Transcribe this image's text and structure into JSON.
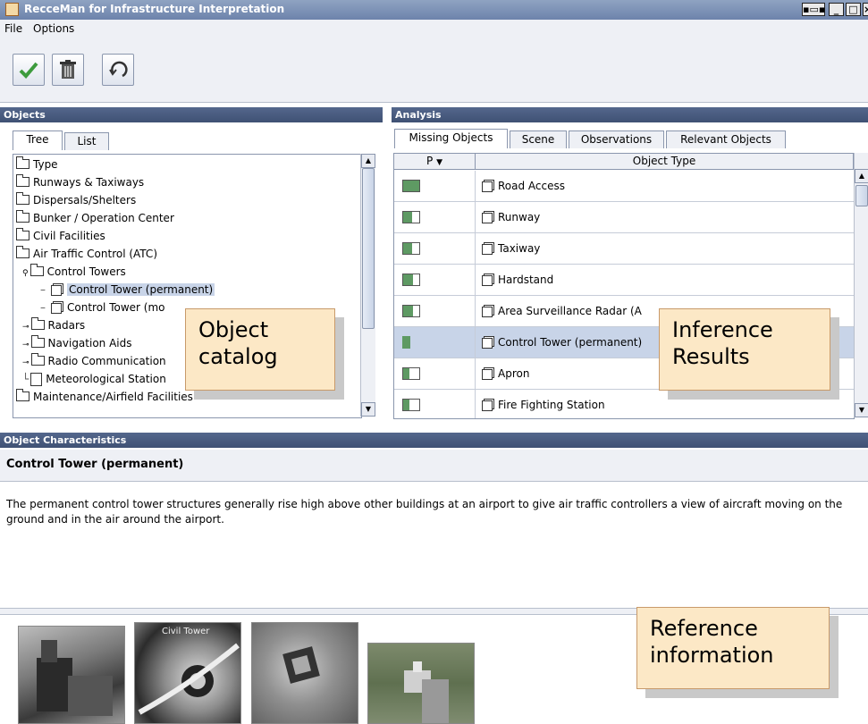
{
  "window": {
    "title": "RecceMan for Infrastructure Interpretation"
  },
  "menu": [
    "File",
    "Options"
  ],
  "toolbar": {
    "icons": [
      "checkmark-icon",
      "trash-icon",
      "refresh-icon"
    ]
  },
  "objects_panel": {
    "header": "Objects",
    "tabs": [
      "Tree",
      "List"
    ],
    "tree_items": [
      {
        "label": "Type",
        "indent": 0,
        "icon": "folder"
      },
      {
        "label": "Runways & Taxiways",
        "indent": 0,
        "icon": "folder"
      },
      {
        "label": "Dispersals/Shelters",
        "indent": 0,
        "icon": "folder"
      },
      {
        "label": "Bunker / Operation Center",
        "indent": 0,
        "icon": "folder"
      },
      {
        "label": "Civil Facilities",
        "indent": 0,
        "icon": "folder"
      },
      {
        "label": "Air Traffic Control (ATC)",
        "indent": 0,
        "icon": "folder"
      },
      {
        "label": "Control Towers",
        "indent": 1,
        "icon": "folder"
      },
      {
        "label": "Control Tower (permanent)",
        "indent": 2,
        "icon": "cube",
        "selected": true
      },
      {
        "label": "Control Tower (mo",
        "indent": 2,
        "icon": "cube"
      },
      {
        "label": "Radars",
        "indent": 1,
        "icon": "folder"
      },
      {
        "label": "Navigation Aids",
        "indent": 1,
        "icon": "folder"
      },
      {
        "label": "Radio Communication",
        "indent": 1,
        "icon": "folder"
      },
      {
        "label": "Meteorological Station",
        "indent": 1,
        "icon": "doc"
      },
      {
        "label": "Maintenance/Airfield Facilities",
        "indent": 0,
        "icon": "folder"
      }
    ]
  },
  "analysis_panel": {
    "header": "Analysis",
    "tabs": [
      "Missing Objects",
      "Scene",
      "Observations",
      "Relevant Objects"
    ],
    "columns": [
      "P",
      "Object Type"
    ],
    "rows": [
      {
        "type": "Road Access",
        "p": 1.0
      },
      {
        "type": "Runway",
        "p": 0.55
      },
      {
        "type": "Taxiway",
        "p": 0.55
      },
      {
        "type": "Hardstand",
        "p": 0.6
      },
      {
        "type": "Area Surveillance Radar (A",
        "p": 0.6
      },
      {
        "type": "Control Tower (permanent)",
        "p": 0.45,
        "selected": true
      },
      {
        "type": "Apron",
        "p": 0.4
      },
      {
        "type": "Fire Fighting Station",
        "p": 0.4
      }
    ]
  },
  "callouts": {
    "catalog": [
      "Object",
      "catalog"
    ],
    "inference": [
      "Inference",
      "Results"
    ],
    "reference": [
      "Reference",
      "information"
    ]
  },
  "characteristics": {
    "header": "Object Characteristics",
    "title": "Control Tower (permanent)",
    "description": "The permanent control tower structures generally rise high above other buildings at an airport to give air traffic controllers a view of aircraft moving on the ground and in the air around the airport.",
    "photo_caption": "Civil Tower"
  },
  "colors": {
    "selection": "#c8d4e8",
    "header": "#3f5174",
    "prob_fill": "#5e9a63",
    "callout": "#fce8c6"
  }
}
